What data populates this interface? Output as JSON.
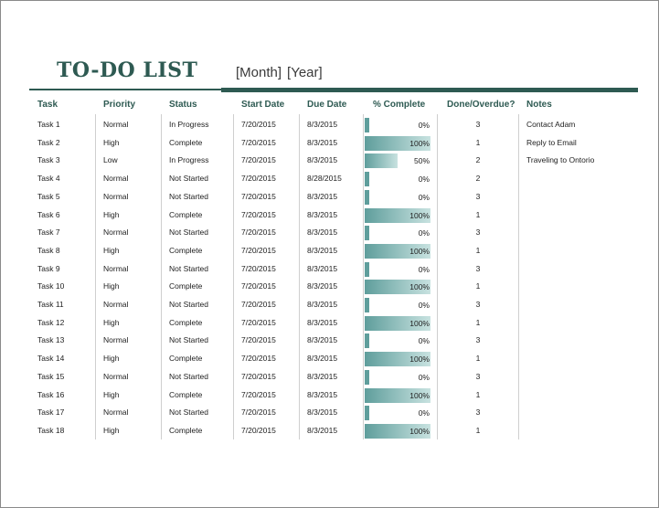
{
  "title": "TO-DO LIST",
  "period": {
    "month": "[Month]",
    "year": "[Year]"
  },
  "columns": {
    "task": "Task",
    "priority": "Priority",
    "status": "Status",
    "start": "Start Date",
    "due": "Due Date",
    "pct": "% Complete",
    "done": "Done/Overdue?",
    "notes": "Notes"
  },
  "colors": {
    "accent": "#2e5a52",
    "bar": "#5f9e9c"
  },
  "rows": [
    {
      "task": "Task 1",
      "priority": "Normal",
      "status": "In Progress",
      "start": "7/20/2015",
      "due": "8/3/2015",
      "pct": "0%",
      "pct_value": 0,
      "done": "3",
      "notes": "Contact Adam"
    },
    {
      "task": "Task 2",
      "priority": "High",
      "status": "Complete",
      "start": "7/20/2015",
      "due": "8/3/2015",
      "pct": "100%",
      "pct_value": 100,
      "done": "1",
      "notes": "Reply to Email"
    },
    {
      "task": "Task 3",
      "priority": "Low",
      "status": "In Progress",
      "start": "7/20/2015",
      "due": "8/3/2015",
      "pct": "50%",
      "pct_value": 50,
      "done": "2",
      "notes": "Traveling to Ontorio"
    },
    {
      "task": "Task 4",
      "priority": "Normal",
      "status": "Not Started",
      "start": "7/20/2015",
      "due": "8/28/2015",
      "pct": "0%",
      "pct_value": 0,
      "done": "2",
      "notes": ""
    },
    {
      "task": "Task 5",
      "priority": "Normal",
      "status": "Not Started",
      "start": "7/20/2015",
      "due": "8/3/2015",
      "pct": "0%",
      "pct_value": 0,
      "done": "3",
      "notes": ""
    },
    {
      "task": "Task 6",
      "priority": "High",
      "status": "Complete",
      "start": "7/20/2015",
      "due": "8/3/2015",
      "pct": "100%",
      "pct_value": 100,
      "done": "1",
      "notes": ""
    },
    {
      "task": "Task 7",
      "priority": "Normal",
      "status": "Not Started",
      "start": "7/20/2015",
      "due": "8/3/2015",
      "pct": "0%",
      "pct_value": 0,
      "done": "3",
      "notes": ""
    },
    {
      "task": "Task 8",
      "priority": "High",
      "status": "Complete",
      "start": "7/20/2015",
      "due": "8/3/2015",
      "pct": "100%",
      "pct_value": 100,
      "done": "1",
      "notes": ""
    },
    {
      "task": "Task 9",
      "priority": "Normal",
      "status": "Not Started",
      "start": "7/20/2015",
      "due": "8/3/2015",
      "pct": "0%",
      "pct_value": 0,
      "done": "3",
      "notes": ""
    },
    {
      "task": "Task 10",
      "priority": "High",
      "status": "Complete",
      "start": "7/20/2015",
      "due": "8/3/2015",
      "pct": "100%",
      "pct_value": 100,
      "done": "1",
      "notes": ""
    },
    {
      "task": "Task 11",
      "priority": "Normal",
      "status": "Not Started",
      "start": "7/20/2015",
      "due": "8/3/2015",
      "pct": "0%",
      "pct_value": 0,
      "done": "3",
      "notes": ""
    },
    {
      "task": "Task 12",
      "priority": "High",
      "status": "Complete",
      "start": "7/20/2015",
      "due": "8/3/2015",
      "pct": "100%",
      "pct_value": 100,
      "done": "1",
      "notes": ""
    },
    {
      "task": "Task 13",
      "priority": "Normal",
      "status": "Not Started",
      "start": "7/20/2015",
      "due": "8/3/2015",
      "pct": "0%",
      "pct_value": 0,
      "done": "3",
      "notes": ""
    },
    {
      "task": "Task 14",
      "priority": "High",
      "status": "Complete",
      "start": "7/20/2015",
      "due": "8/3/2015",
      "pct": "100%",
      "pct_value": 100,
      "done": "1",
      "notes": ""
    },
    {
      "task": "Task 15",
      "priority": "Normal",
      "status": "Not Started",
      "start": "7/20/2015",
      "due": "8/3/2015",
      "pct": "0%",
      "pct_value": 0,
      "done": "3",
      "notes": ""
    },
    {
      "task": "Task 16",
      "priority": "High",
      "status": "Complete",
      "start": "7/20/2015",
      "due": "8/3/2015",
      "pct": "100%",
      "pct_value": 100,
      "done": "1",
      "notes": ""
    },
    {
      "task": "Task 17",
      "priority": "Normal",
      "status": "Not Started",
      "start": "7/20/2015",
      "due": "8/3/2015",
      "pct": "0%",
      "pct_value": 0,
      "done": "3",
      "notes": ""
    },
    {
      "task": "Task 18",
      "priority": "High",
      "status": "Complete",
      "start": "7/20/2015",
      "due": "8/3/2015",
      "pct": "100%",
      "pct_value": 100,
      "done": "1",
      "notes": ""
    }
  ]
}
